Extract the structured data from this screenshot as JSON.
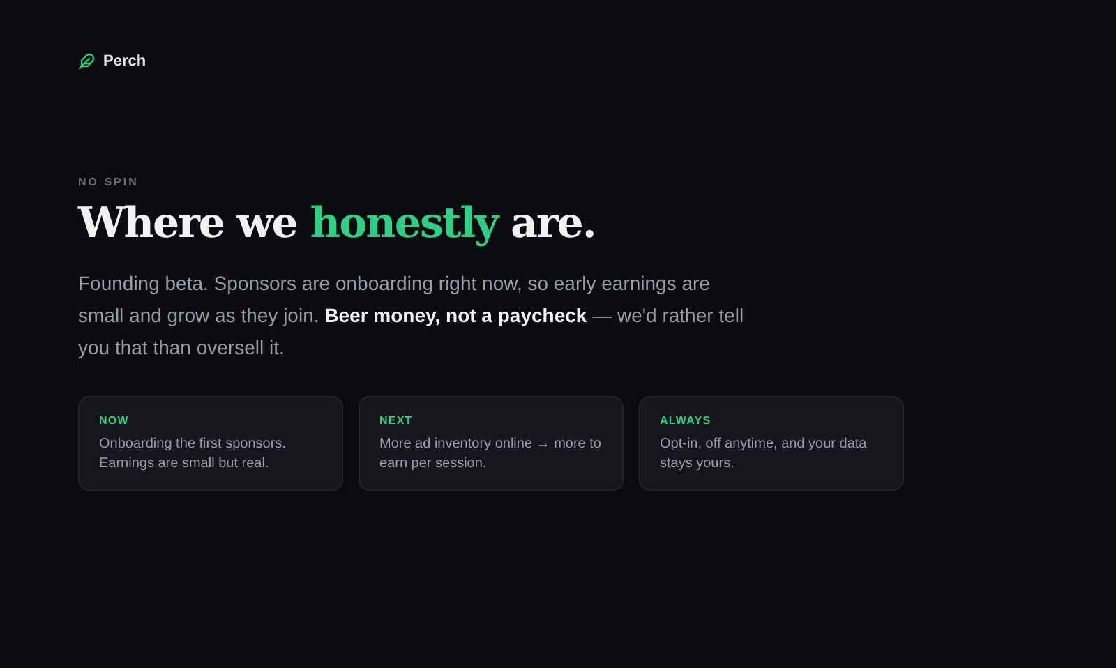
{
  "brand": {
    "name": "Perch"
  },
  "eyebrow": "NO SPIN",
  "heading": [
    {
      "text": "Where we ",
      "accent": false
    },
    {
      "text": "honestly",
      "accent": true
    },
    {
      "text": " are.",
      "accent": false
    }
  ],
  "intro": "Founding beta. Sponsors are onboarding right now, so early earnings are small and grow as they join. **Beer money, not a paycheck** — we'd rather tell you that than oversell it.",
  "cards": [
    {
      "label": "NOW",
      "text": "Onboarding the first sponsors. Earnings are small but real."
    },
    {
      "label": "NEXT",
      "text": "More ad inventory online → more to earn per session."
    },
    {
      "label": "ALWAYS",
      "text": "Opt-in, off anytime, and your data stays yours."
    }
  ]
}
